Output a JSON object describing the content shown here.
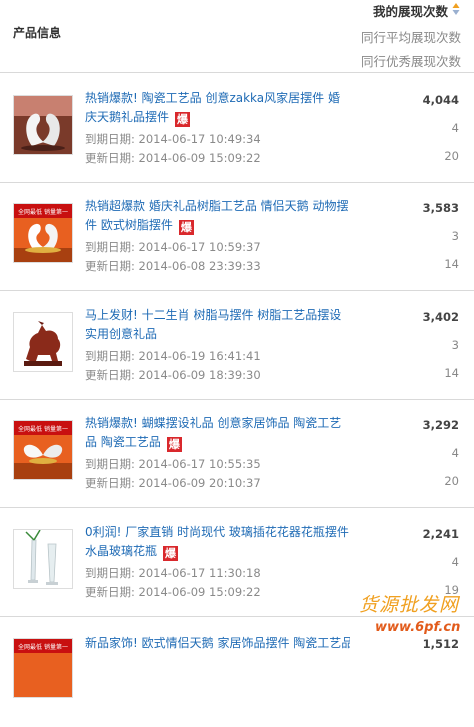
{
  "header": {
    "product_info": "产品信息",
    "my_views": "我的展现次数",
    "peer_avg": "同行平均展现次数",
    "peer_best": "同行优秀展现次数"
  },
  "labels": {
    "expiry": "到期日期:",
    "update": "更新日期:",
    "hot_badge": "爆"
  },
  "rows": [
    {
      "title": "热销爆款! 陶瓷工艺品 创意zakka风家居摆件 婚庆天鹅礼品摆件",
      "expiry": "2014-06-17 10:49:34",
      "update": "2014-06-09 15:09:22",
      "my": "4,044",
      "avg": "4",
      "best": "20",
      "thumb_icon": "ceramic-swans-image"
    },
    {
      "title": "热销超爆款 婚庆礼品树脂工艺品 情侣天鹅 动物摆件 欧式树脂摆件",
      "expiry": "2014-06-17 10:59:37",
      "update": "2014-06-08 23:39:33",
      "my": "3,583",
      "avg": "3",
      "best": "14",
      "thumb_icon": "resin-swans-image",
      "thumb_banner": "全网最低 销量第一"
    },
    {
      "title": "马上发财! 十二生肖 树脂马摆件 树脂工艺品摆设 实用创意礼品",
      "expiry": "2014-06-19 16:41:41",
      "update": "2014-06-09 18:39:30",
      "my": "3,402",
      "avg": "3",
      "best": "14",
      "thumb_icon": "resin-horse-image"
    },
    {
      "title": "热销爆款! 蝴蝶摆设礼品 创意家居饰品 陶瓷工艺品 陶瓷工艺品",
      "expiry": "2014-06-17 10:55:35",
      "update": "2014-06-09 20:10:37",
      "my": "3,292",
      "avg": "4",
      "best": "20",
      "thumb_icon": "butterfly-ornament-image",
      "thumb_banner": "全网最低 销量第一"
    },
    {
      "title": "0利润! 厂家直销 时尚现代 玻璃插花花器花瓶摆件 水晶玻璃花瓶",
      "expiry": "2014-06-17 11:30:18",
      "update": "2014-06-09 15:09:22",
      "my": "2,241",
      "avg": "4",
      "best": "19",
      "thumb_icon": "glass-vase-image"
    },
    {
      "title": "新品家饰! 欧式情侣天鹅 家居饰品摆件 陶瓷工艺品",
      "my": "1,512",
      "thumb_icon": "swan-product-image",
      "thumb_banner": "全网最低 销量第一"
    }
  ],
  "watermark": {
    "top": "货源批发网",
    "bottom": "www.6pf.cn"
  }
}
